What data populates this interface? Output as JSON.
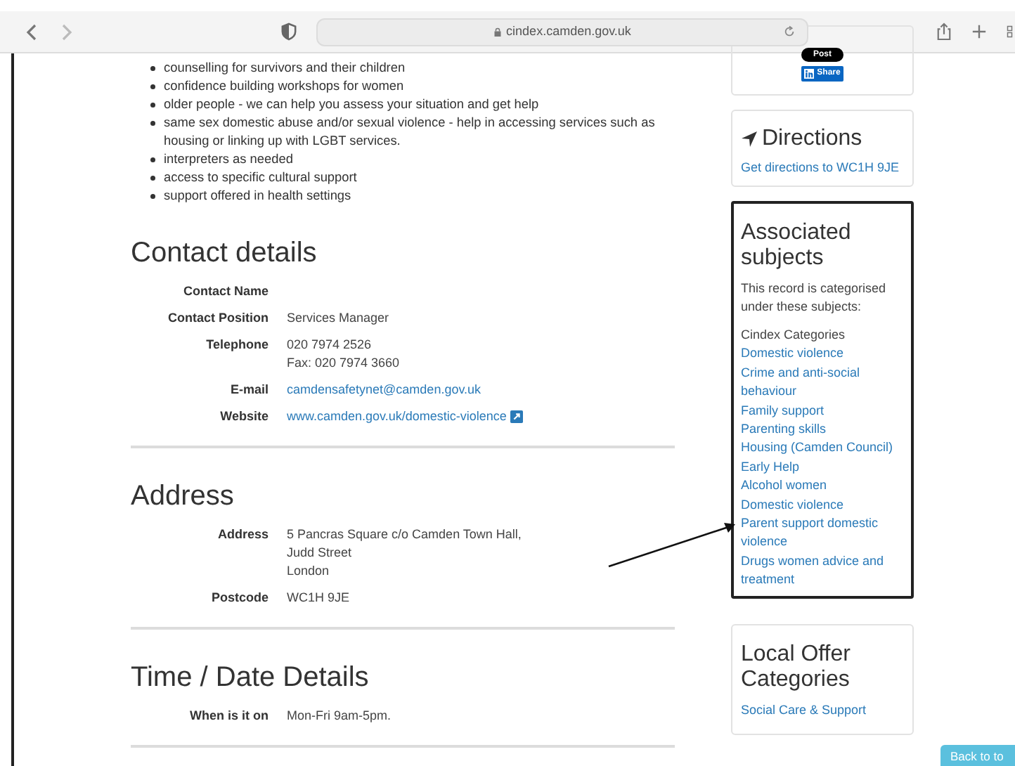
{
  "browser": {
    "url": "cindex.camden.gov.uk"
  },
  "services_list": [
    "counselling for survivors and their children",
    "confidence building workshops for women",
    "older people - we can help you assess your situation and get help",
    "same sex domestic abuse and/or sexual violence - help in accessing services such as housing or linking up with LGBT services.",
    "interpreters as needed",
    "access to specific cultural support",
    "support offered in health settings"
  ],
  "sections": [
    {
      "title": "Contact details",
      "rows": [
        {
          "label": "Contact Name",
          "values": []
        },
        {
          "label": "Contact Position",
          "values": [
            {
              "text": "Services Manager",
              "kind": "text"
            }
          ]
        },
        {
          "label": "Telephone",
          "values": [
            {
              "text": "020 7974 2526",
              "kind": "text"
            },
            {
              "text": "Fax: 020 7974 3660",
              "kind": "text"
            }
          ]
        },
        {
          "label": "E-mail",
          "values": [
            {
              "text": "camdensafetynet@camden.gov.uk",
              "kind": "link"
            }
          ]
        },
        {
          "label": "Website",
          "values": [
            {
              "text": "www.camden.gov.uk/domestic-violence",
              "kind": "external_link"
            }
          ]
        }
      ]
    },
    {
      "title": "Address",
      "rows": [
        {
          "label": "Address",
          "values": [
            {
              "text": "5 Pancras Square c/o Camden Town Hall,",
              "kind": "text"
            },
            {
              "text": "Judd Street",
              "kind": "text"
            },
            {
              "text": "London",
              "kind": "text"
            }
          ]
        },
        {
          "label": "Postcode",
          "values": [
            {
              "text": "WC1H 9JE",
              "kind": "text"
            }
          ]
        }
      ]
    },
    {
      "title": "Time / Date Details",
      "rows": [
        {
          "label": "When is it on",
          "values": [
            {
              "text": "Mon-Fri 9am-5pm.",
              "kind": "text"
            }
          ]
        }
      ]
    }
  ],
  "sidebar": {
    "share": {
      "post": "Post",
      "linkedin": "Share"
    },
    "directions": {
      "title": "Directions",
      "link": "Get directions to WC1H 9JE"
    },
    "associated": {
      "title": "Associated subjects",
      "intro": "This record is categorised under these subjects:",
      "group": "Cindex Categories",
      "highlighted": true,
      "links": [
        "Domestic violence",
        "Crime and anti-social behaviour",
        "Family support",
        "Parenting skills",
        "Housing (Camden Council)",
        "Early Help",
        "Alcohol women",
        "Domestic violence",
        "Parent support domestic violence",
        "Drugs women advice and treatment"
      ]
    },
    "local_offer": {
      "title": "Local Offer Categories",
      "links": [
        "Social Care & Support"
      ]
    }
  },
  "back_to_top": "Back to to"
}
